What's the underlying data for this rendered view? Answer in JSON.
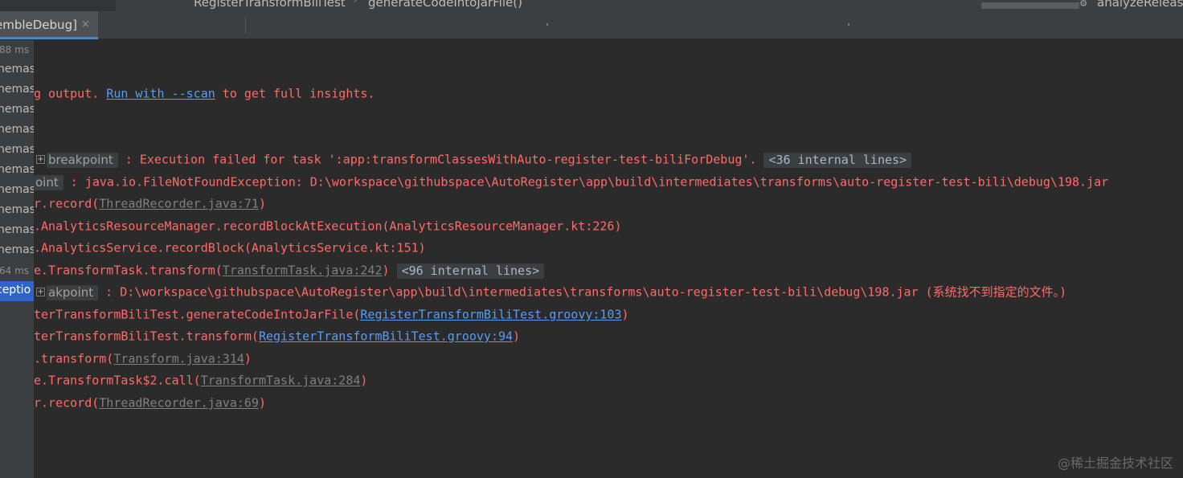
{
  "topbar": {
    "crumb1": "RegisterTransformBiliTest",
    "separator": "›",
    "crumb2": "generateCodeIntoJarFile()",
    "run_config_icon": "gear-icon",
    "run_config": "analyzeRelease"
  },
  "tabs": {
    "active_label": "embleDebug]",
    "close_glyph": "×"
  },
  "tree": {
    "items": [
      {
        "text": "88 ms",
        "kind": "small"
      },
      {
        "text": "hemas"
      },
      {
        "text": "hemas"
      },
      {
        "text": "hemas"
      },
      {
        "text": "hemas"
      },
      {
        "text": "hemas"
      },
      {
        "text": "hemas"
      },
      {
        "text": "hemas"
      },
      {
        "text": "hemas"
      },
      {
        "text": "hemas"
      },
      {
        "text": "hemas"
      },
      {
        "text": "64 ms",
        "kind": "small"
      },
      {
        "text": "ceptio",
        "kind": "selected"
      }
    ]
  },
  "console": {
    "l1_pre": "g output. ",
    "l1_link": "Run with --scan",
    "l1_post": " to get full insights.",
    "l2_bp": "breakpoint",
    "l2_text": " : Execution failed for task ':app:transformClassesWithAuto-register-test-biliForDebug'.",
    "l2_fold": "<36 internal lines>",
    "l3_bp": "oint",
    "l3_text": " : java.io.FileNotFoundException: D:\\workspace\\githubspace\\AutoRegister\\app\\build\\intermediates\\transforms\\auto-register-test-bili\\debug\\198.jar",
    "l4_pre": "r.record(",
    "l4_src": "ThreadRecorder.java:71",
    "l4_post": ")",
    "l5": ".AnalyticsResourceManager.recordBlockAtExecution(AnalyticsResourceManager.kt:226)",
    "l6": ".AnalyticsService.recordBlock(AnalyticsService.kt:151)",
    "l7_pre": "e.TransformTask.transform(",
    "l7_src": "TransformTask.java:242",
    "l7_post": ")",
    "l7_fold": "<96 internal lines>",
    "l8_bp": "akpoint",
    "l8_text": " : D:\\workspace\\githubspace\\AutoRegister\\app\\build\\intermediates\\transforms\\auto-register-test-bili\\debug\\198.jar (系统找不到指定的文件。)",
    "l9_pre": "terTransformBiliTest.generateCodeIntoJarFile(",
    "l9_link": "RegisterTransformBiliTest.groovy:103",
    "l9_post": ")",
    "l10_pre": "terTransformBiliTest.transform(",
    "l10_link": "RegisterTransformBiliTest.groovy:94",
    "l10_post": ")",
    "l11_pre": ".transform(",
    "l11_src": "Transform.java:314",
    "l11_post": ")",
    "l12_pre": "e.TransformTask$2.call(",
    "l12_src": "TransformTask.java:284",
    "l12_post": ")",
    "l13_pre": "r.record(",
    "l13_src": "ThreadRecorder.java:69",
    "l13_post": ")"
  },
  "watermark": "@稀土掘金技术社区",
  "colors": {
    "error": "#ff6b68",
    "link": "#589df6",
    "selection": "#2f65ca",
    "background": "#2b2b2b"
  }
}
